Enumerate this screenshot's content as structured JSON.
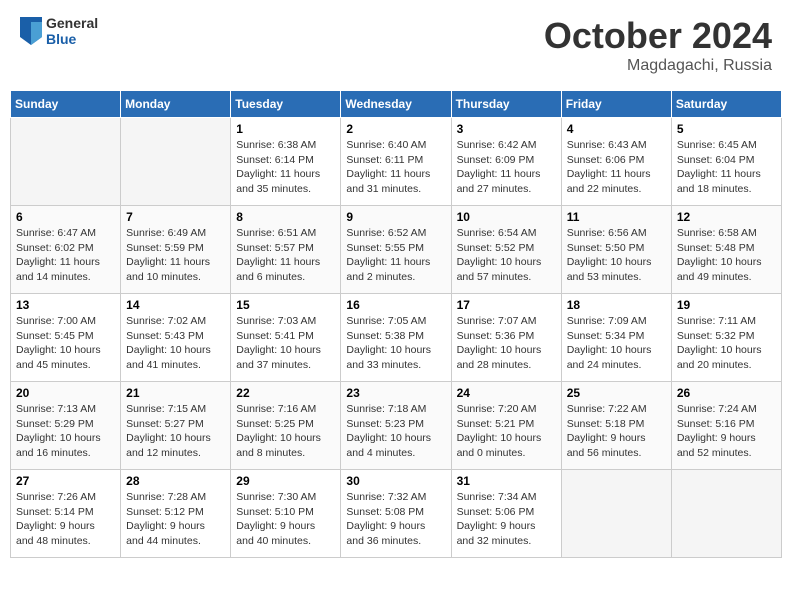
{
  "header": {
    "logo_general": "General",
    "logo_blue": "Blue",
    "title": "October 2024",
    "location": "Magdagachi, Russia"
  },
  "days_of_week": [
    "Sunday",
    "Monday",
    "Tuesday",
    "Wednesday",
    "Thursday",
    "Friday",
    "Saturday"
  ],
  "weeks": [
    [
      {
        "num": "",
        "info": ""
      },
      {
        "num": "",
        "info": ""
      },
      {
        "num": "1",
        "info": "Sunrise: 6:38 AM\nSunset: 6:14 PM\nDaylight: 11 hours and 35 minutes."
      },
      {
        "num": "2",
        "info": "Sunrise: 6:40 AM\nSunset: 6:11 PM\nDaylight: 11 hours and 31 minutes."
      },
      {
        "num": "3",
        "info": "Sunrise: 6:42 AM\nSunset: 6:09 PM\nDaylight: 11 hours and 27 minutes."
      },
      {
        "num": "4",
        "info": "Sunrise: 6:43 AM\nSunset: 6:06 PM\nDaylight: 11 hours and 22 minutes."
      },
      {
        "num": "5",
        "info": "Sunrise: 6:45 AM\nSunset: 6:04 PM\nDaylight: 11 hours and 18 minutes."
      }
    ],
    [
      {
        "num": "6",
        "info": "Sunrise: 6:47 AM\nSunset: 6:02 PM\nDaylight: 11 hours and 14 minutes."
      },
      {
        "num": "7",
        "info": "Sunrise: 6:49 AM\nSunset: 5:59 PM\nDaylight: 11 hours and 10 minutes."
      },
      {
        "num": "8",
        "info": "Sunrise: 6:51 AM\nSunset: 5:57 PM\nDaylight: 11 hours and 6 minutes."
      },
      {
        "num": "9",
        "info": "Sunrise: 6:52 AM\nSunset: 5:55 PM\nDaylight: 11 hours and 2 minutes."
      },
      {
        "num": "10",
        "info": "Sunrise: 6:54 AM\nSunset: 5:52 PM\nDaylight: 10 hours and 57 minutes."
      },
      {
        "num": "11",
        "info": "Sunrise: 6:56 AM\nSunset: 5:50 PM\nDaylight: 10 hours and 53 minutes."
      },
      {
        "num": "12",
        "info": "Sunrise: 6:58 AM\nSunset: 5:48 PM\nDaylight: 10 hours and 49 minutes."
      }
    ],
    [
      {
        "num": "13",
        "info": "Sunrise: 7:00 AM\nSunset: 5:45 PM\nDaylight: 10 hours and 45 minutes."
      },
      {
        "num": "14",
        "info": "Sunrise: 7:02 AM\nSunset: 5:43 PM\nDaylight: 10 hours and 41 minutes."
      },
      {
        "num": "15",
        "info": "Sunrise: 7:03 AM\nSunset: 5:41 PM\nDaylight: 10 hours and 37 minutes."
      },
      {
        "num": "16",
        "info": "Sunrise: 7:05 AM\nSunset: 5:38 PM\nDaylight: 10 hours and 33 minutes."
      },
      {
        "num": "17",
        "info": "Sunrise: 7:07 AM\nSunset: 5:36 PM\nDaylight: 10 hours and 28 minutes."
      },
      {
        "num": "18",
        "info": "Sunrise: 7:09 AM\nSunset: 5:34 PM\nDaylight: 10 hours and 24 minutes."
      },
      {
        "num": "19",
        "info": "Sunrise: 7:11 AM\nSunset: 5:32 PM\nDaylight: 10 hours and 20 minutes."
      }
    ],
    [
      {
        "num": "20",
        "info": "Sunrise: 7:13 AM\nSunset: 5:29 PM\nDaylight: 10 hours and 16 minutes."
      },
      {
        "num": "21",
        "info": "Sunrise: 7:15 AM\nSunset: 5:27 PM\nDaylight: 10 hours and 12 minutes."
      },
      {
        "num": "22",
        "info": "Sunrise: 7:16 AM\nSunset: 5:25 PM\nDaylight: 10 hours and 8 minutes."
      },
      {
        "num": "23",
        "info": "Sunrise: 7:18 AM\nSunset: 5:23 PM\nDaylight: 10 hours and 4 minutes."
      },
      {
        "num": "24",
        "info": "Sunrise: 7:20 AM\nSunset: 5:21 PM\nDaylight: 10 hours and 0 minutes."
      },
      {
        "num": "25",
        "info": "Sunrise: 7:22 AM\nSunset: 5:18 PM\nDaylight: 9 hours and 56 minutes."
      },
      {
        "num": "26",
        "info": "Sunrise: 7:24 AM\nSunset: 5:16 PM\nDaylight: 9 hours and 52 minutes."
      }
    ],
    [
      {
        "num": "27",
        "info": "Sunrise: 7:26 AM\nSunset: 5:14 PM\nDaylight: 9 hours and 48 minutes."
      },
      {
        "num": "28",
        "info": "Sunrise: 7:28 AM\nSunset: 5:12 PM\nDaylight: 9 hours and 44 minutes."
      },
      {
        "num": "29",
        "info": "Sunrise: 7:30 AM\nSunset: 5:10 PM\nDaylight: 9 hours and 40 minutes."
      },
      {
        "num": "30",
        "info": "Sunrise: 7:32 AM\nSunset: 5:08 PM\nDaylight: 9 hours and 36 minutes."
      },
      {
        "num": "31",
        "info": "Sunrise: 7:34 AM\nSunset: 5:06 PM\nDaylight: 9 hours and 32 minutes."
      },
      {
        "num": "",
        "info": ""
      },
      {
        "num": "",
        "info": ""
      }
    ]
  ]
}
